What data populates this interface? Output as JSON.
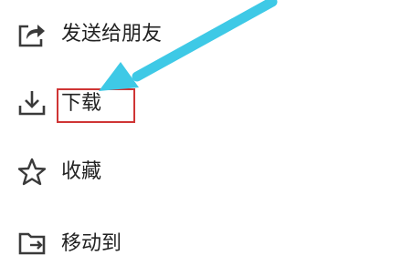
{
  "menu": {
    "items": [
      {
        "label": "发送给朋友",
        "icon": "share-icon"
      },
      {
        "label": "下载",
        "icon": "download-icon"
      },
      {
        "label": "收藏",
        "icon": "star-icon"
      },
      {
        "label": "移动到",
        "icon": "folder-move-icon"
      }
    ]
  },
  "annotation": {
    "arrow_color": "#3ec9e6",
    "highlight_color": "#cf3535",
    "highlighted_item": "下载"
  }
}
